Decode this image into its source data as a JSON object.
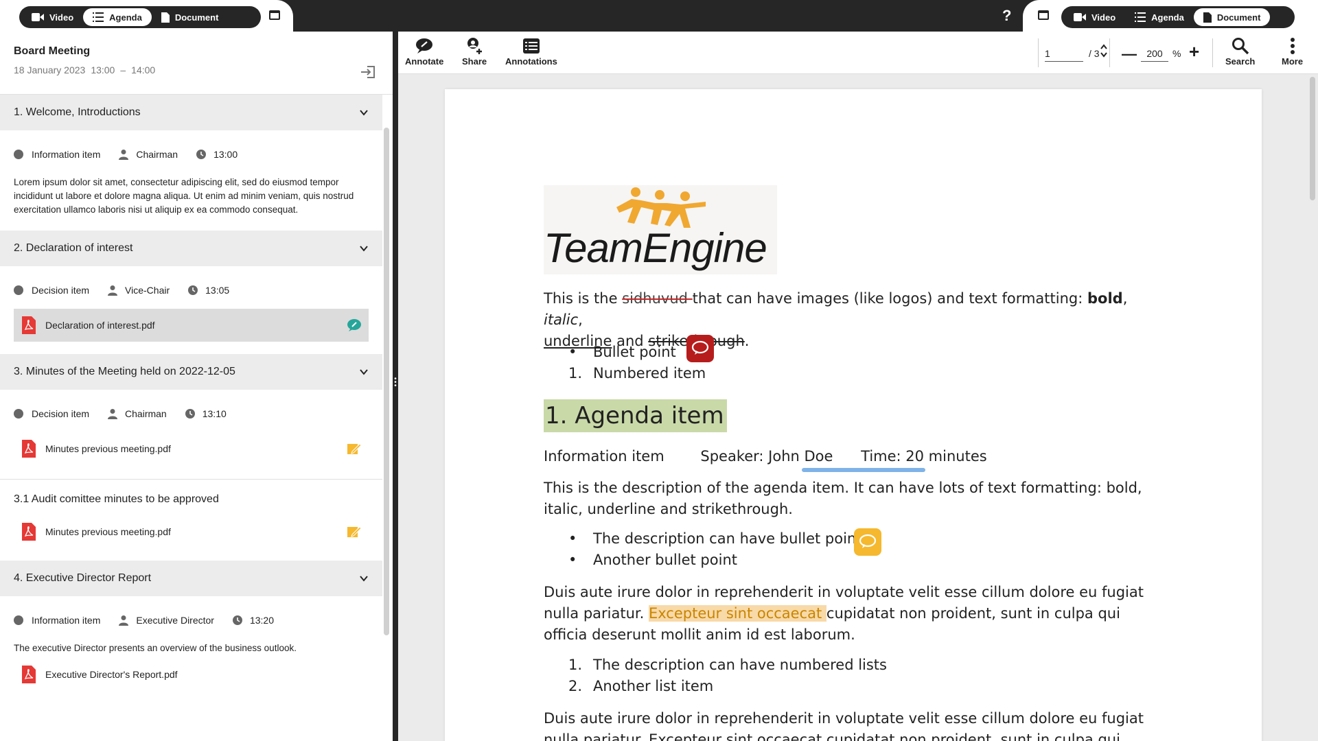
{
  "view_switcher": {
    "video": "Video",
    "agenda": "Agenda",
    "document": "Document"
  },
  "help_label": "?",
  "meeting": {
    "title": "Board Meeting",
    "date": "18 January 2023",
    "start": "13:00",
    "separator": "–",
    "end": "14:00"
  },
  "agenda": {
    "items": [
      {
        "title": "1. Welcome, Introductions",
        "type": "Information item",
        "speaker": "Chairman",
        "time": "13:00",
        "description": "Lorem ipsum dolor sit amet, consectetur adipiscing elit, sed do eiusmod tempor incididunt ut labore et dolore magna aliqua. Ut enim ad minim veniam, quis nostrud exercitation ullamco laboris nisi ut aliquip ex ea commodo consequat."
      },
      {
        "title": "2. Declaration of interest",
        "type": "Decision item",
        "speaker": "Vice-Chair",
        "time": "13:05",
        "file": "Declaration of interest.pdf"
      },
      {
        "title": "3. Minutes of the Meeting held on 2022-12-05",
        "type": "Decision item",
        "speaker": "Chairman",
        "time": "13:10",
        "file": "Minutes previous meeting.pdf",
        "sub_title": "3.1 Audit comittee minutes to be approved",
        "sub_file": "Minutes previous meeting.pdf"
      },
      {
        "title": "4. Executive Director Report",
        "type": "Information item",
        "speaker": "Executive Director",
        "time": "13:20",
        "description": "The executive Director presents an overview of the business outlook.",
        "file": "Executive Director's Report.pdf"
      }
    ]
  },
  "toolbar": {
    "annotate": "Annotate",
    "share": "Share",
    "annotations": "Annotations",
    "page_current": "1",
    "page_total": "/ 3",
    "zoom_value": "200",
    "zoom_unit": "%",
    "search": "Search",
    "more": "More"
  },
  "document": {
    "logo_text": "TeamEngine",
    "p1_a": "This is the ",
    "p1_struck_red": "sidhuvud ",
    "p1_b": "that can have images (like logos) and text formatting: ",
    "p1_bold": "bold",
    "p1_comma": ", ",
    "p1_italic": "italic",
    "p1_c": ",",
    "p1_underline": "underline",
    "p1_and": " and ",
    "p1_strike": "strikethrough",
    "p1_end": ".",
    "bullet1": "Bullet point",
    "numbered1_mark": "1.",
    "numbered1": "Numbered item",
    "heading": "1. Agenda item",
    "info_type": "Information item",
    "speaker": "Speaker: John Doe",
    "time": "Time: 20 minutes",
    "p2": "This is the description of the agenda item. It can have lots of text formatting: bold, italic, underline and strikethrough.",
    "bullet2": "The description can have bullet points",
    "bullet3": "Another bullet point",
    "p3_a": "Duis aute irure dolor in reprehenderit in voluptate velit esse cillum dolore eu fugiat nulla pariatur. ",
    "p3_hl": "Excepteur sint occaecat ",
    "p3_b": "cupidatat non proident, sunt in culpa qui officia deserunt mollit anim id est laborum.",
    "num1_mark": "1.",
    "num1": "The description can have numbered lists",
    "num2_mark": "2.",
    "num2": "Another list item",
    "p4": "Duis aute irure dolor in reprehenderit in voluptate velit esse cillum dolore eu fugiat nulla pariatur. Excepteur sint occaecat cupidatat non proident, sunt in culpa qui officia deserunt"
  },
  "colors": {
    "topbar": "#262626",
    "heading_highlight": "#c9d9a8",
    "text_highlight": "#f8d9a8",
    "comment_red": "#b71c1c",
    "comment_yellow": "#f5b82e",
    "pdf_red": "#e53935",
    "annotate_green": "#26a69a",
    "edit_yellow": "#f5b82e"
  }
}
